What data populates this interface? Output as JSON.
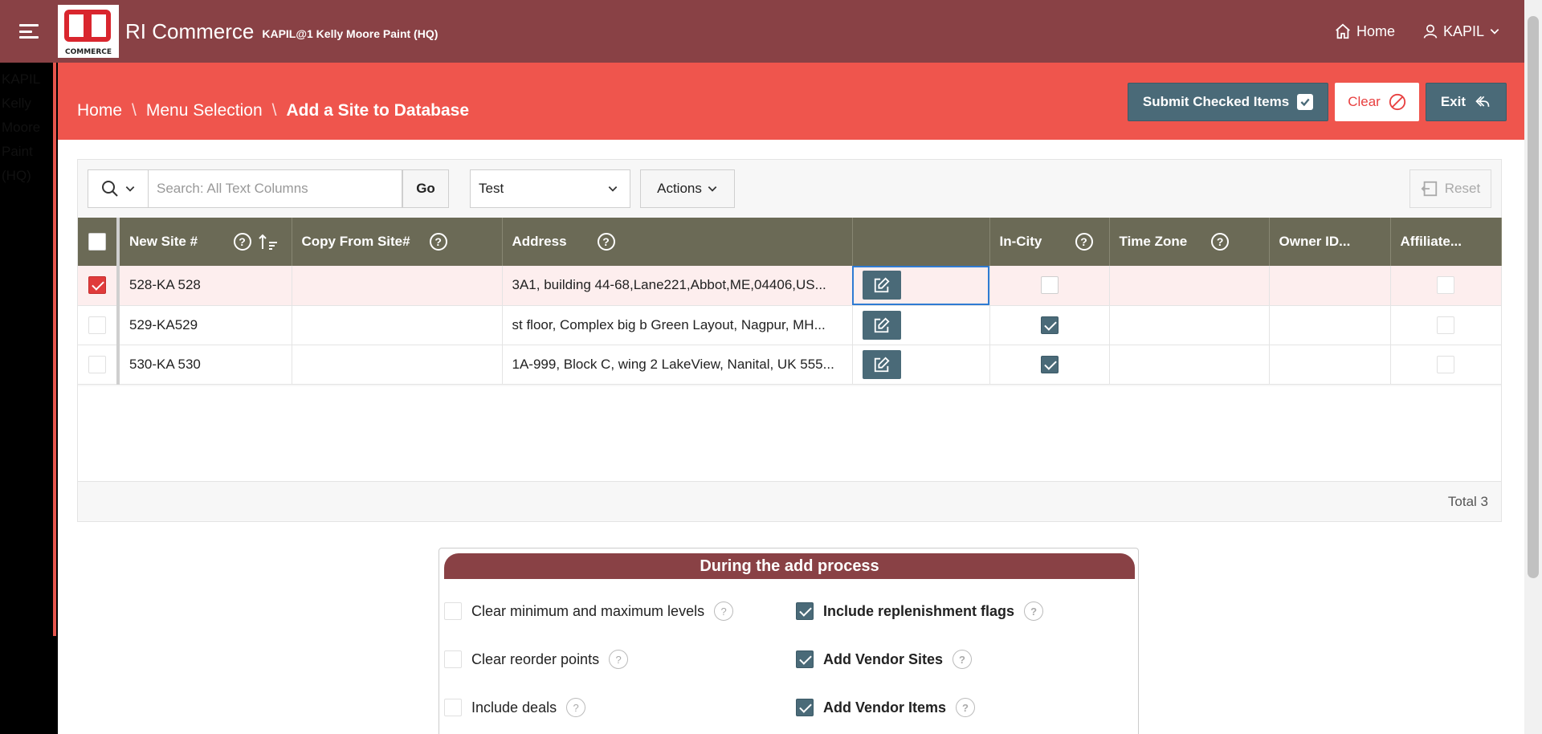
{
  "header": {
    "logo_text": "COMMERCE",
    "app_title": "RI Commerce",
    "context": "KAPIL@1 Kelly Moore Paint (HQ)",
    "home_label": "Home",
    "user_label": "KAPIL"
  },
  "side_text": "KAPIL Kelly Moore Paint (HQ)",
  "breadcrumb": {
    "items": [
      "Home",
      "Menu Selection",
      "Add a Site to Database"
    ],
    "separator": "\\"
  },
  "actions": {
    "submit_label": "Submit Checked Items",
    "clear_label": "Clear",
    "exit_label": "Exit"
  },
  "toolbar": {
    "search_placeholder": "Search: All Text Columns",
    "go_label": "Go",
    "report_selected": "Test",
    "actions_label": "Actions",
    "reset_label": "Reset"
  },
  "grid": {
    "columns": [
      "New Site #",
      "Copy From Site#",
      "Address",
      "",
      "In-City",
      "Time Zone",
      "Owner ID...",
      "Affiliate..."
    ],
    "rows": [
      {
        "site": "528-KA 528",
        "copy_from": "",
        "address": "3A1, building 44-68,Lane221,Abbot,ME,04406,US...",
        "in_city": false,
        "time_zone": "",
        "owner_id": "",
        "affiliate": false,
        "selected": true
      },
      {
        "site": "529-KA529",
        "copy_from": "",
        "address": "st floor, Complex big b Green Layout, Nagpur, MH...",
        "in_city": true,
        "time_zone": "",
        "owner_id": "",
        "affiliate": false,
        "selected": false
      },
      {
        "site": "530-KA 530",
        "copy_from": "",
        "address": "1A-999, Block C, wing 2 LakeView, Nanital, UK 555...",
        "in_city": true,
        "time_zone": "",
        "owner_id": "",
        "affiliate": false,
        "selected": false
      }
    ],
    "total_label": "Total 3"
  },
  "add_process": {
    "title": "During the add process",
    "left_options": [
      {
        "label": "Clear minimum and maximum levels",
        "checked": false
      },
      {
        "label": "Clear reorder points",
        "checked": false
      },
      {
        "label": "Include deals",
        "checked": false
      }
    ],
    "right_options": [
      {
        "label": "Include replenishment flags",
        "checked": true
      },
      {
        "label": "Add Vendor Sites",
        "checked": true
      },
      {
        "label": "Add Vendor Items",
        "checked": true
      }
    ]
  },
  "colors": {
    "header": "#894145",
    "banner": "#ef554d",
    "grid_header": "#6b6a56",
    "button_dark": "#4a6a78"
  }
}
